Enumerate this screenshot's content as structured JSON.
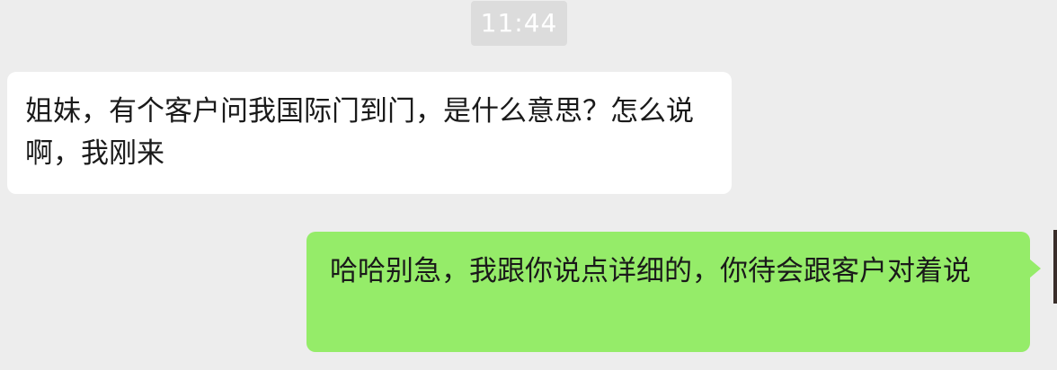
{
  "chat": {
    "timestamp": "11:44",
    "messages": [
      {
        "direction": "incoming",
        "text": "姐妹，有个客户问我国际门到门，是什么意思？怎么说啊，我刚来"
      },
      {
        "direction": "outgoing",
        "text": "哈哈别急，我跟你说点详细的，你待会跟客户对着说"
      }
    ]
  },
  "colors": {
    "background": "#ededed",
    "incoming_bubble": "#ffffff",
    "outgoing_bubble": "#95ec69",
    "timestamp_badge": "#dcdcdc",
    "text": "#1a1a1a"
  }
}
